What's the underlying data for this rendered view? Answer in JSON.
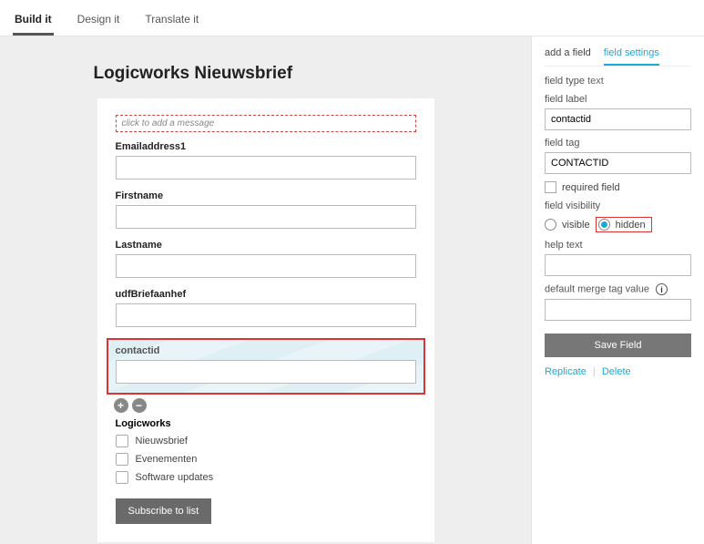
{
  "tabs": {
    "build": "Build it",
    "design": "Design it",
    "translate": "Translate it"
  },
  "form": {
    "title": "Logicworks Nieuwsbrief",
    "message_placeholder": "click to add a message",
    "fields": {
      "email": "Emailaddress1",
      "firstname": "Firstname",
      "lastname": "Lastname",
      "udf": "udfBriefaanhef",
      "contactid": "contactid"
    },
    "checkbox_group": {
      "title": "Logicworks",
      "items": [
        "Nieuwsbrief",
        "Evenementen",
        "Software updates"
      ]
    },
    "submit": "Subscribe to list"
  },
  "settings": {
    "tabs": {
      "add": "add a field",
      "settings": "field settings"
    },
    "field_type_label": "field type",
    "field_type_value": "text",
    "field_label_label": "field label",
    "field_label_value": "contactid",
    "field_tag_label": "field tag",
    "field_tag_value": "CONTACTID",
    "required_label": "required field",
    "visibility_label": "field visibility",
    "visible_label": "visible",
    "hidden_label": "hidden",
    "help_text_label": "help text",
    "default_merge_label": "default merge tag value",
    "save_button": "Save Field",
    "replicate": "Replicate",
    "delete": "Delete"
  }
}
